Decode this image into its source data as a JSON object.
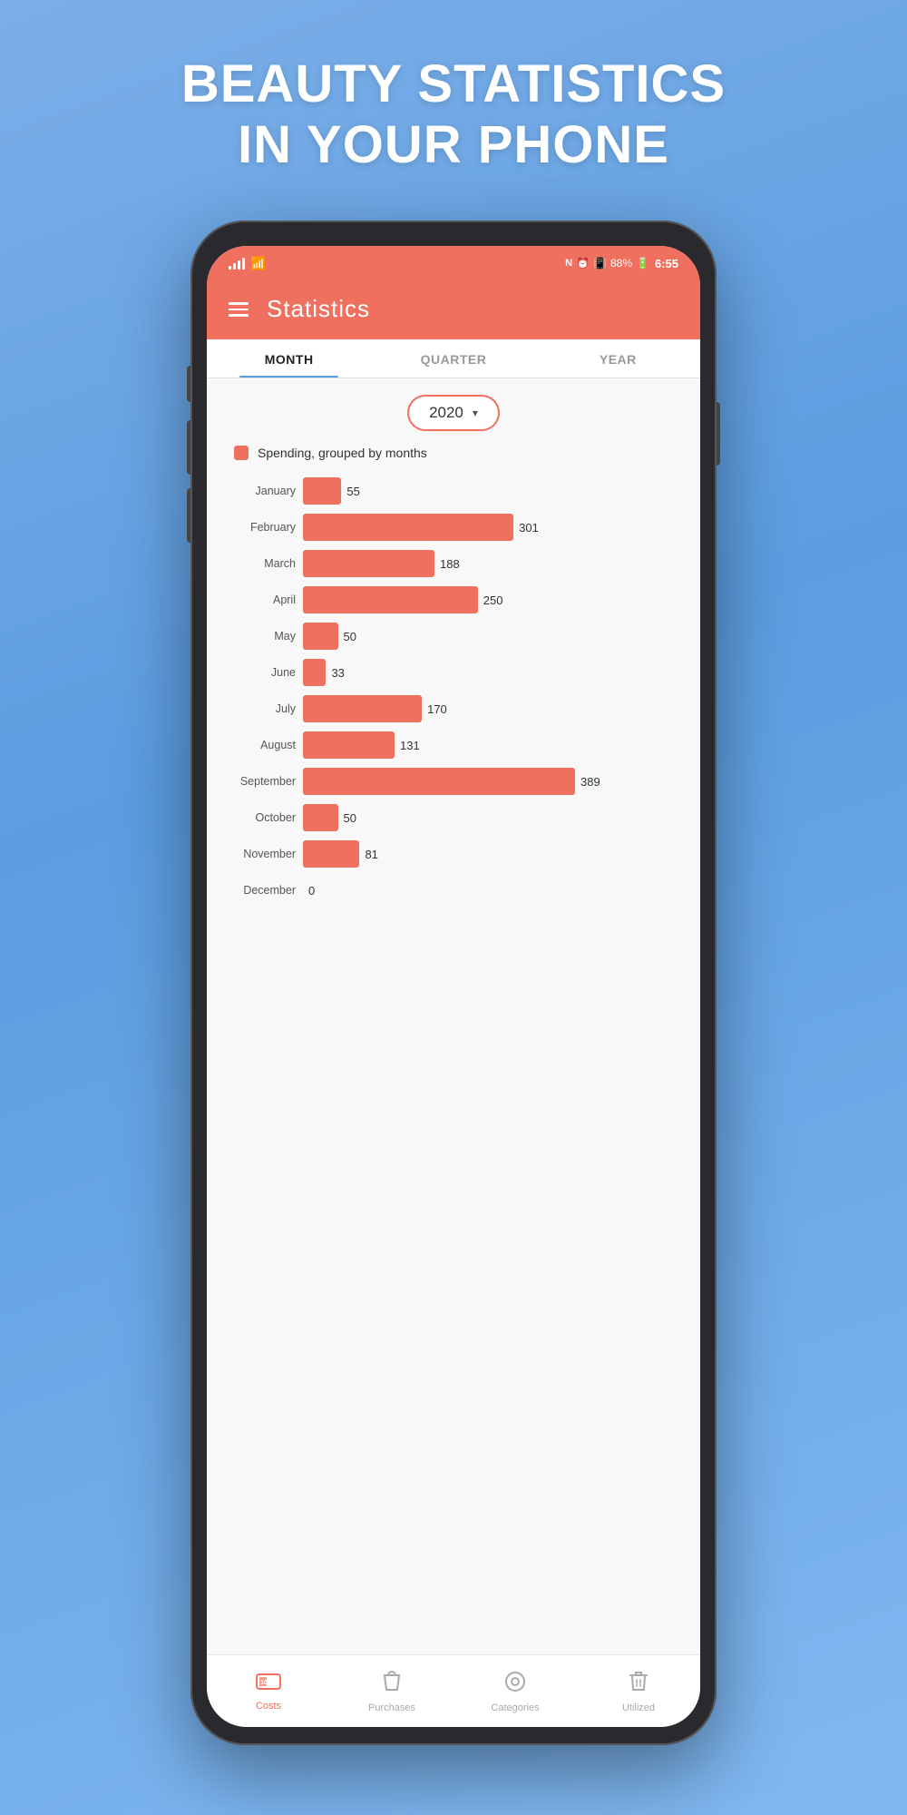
{
  "hero": {
    "line1": "BEAUTY STATISTICS",
    "line2": "IN YOUR PHONE"
  },
  "status_bar": {
    "time": "6:55",
    "battery": "88%",
    "signal": "●●●●",
    "wifi": "wifi"
  },
  "header": {
    "title": "Statistics"
  },
  "tabs": [
    {
      "label": "MONTH",
      "active": true
    },
    {
      "label": "QUARTER",
      "active": false
    },
    {
      "label": "YEAR",
      "active": false
    }
  ],
  "year_selector": {
    "value": "2020"
  },
  "legend": {
    "label": "Spending, grouped by months"
  },
  "chart": {
    "max_value": 389,
    "bar_max_width": 300,
    "bars": [
      {
        "month": "January",
        "value": 55
      },
      {
        "month": "February",
        "value": 301
      },
      {
        "month": "March",
        "value": 188
      },
      {
        "month": "April",
        "value": 250
      },
      {
        "month": "May",
        "value": 50
      },
      {
        "month": "June",
        "value": 33
      },
      {
        "month": "July",
        "value": 170
      },
      {
        "month": "August",
        "value": 131
      },
      {
        "month": "September",
        "value": 389
      },
      {
        "month": "October",
        "value": 50
      },
      {
        "month": "November",
        "value": 81
      },
      {
        "month": "December",
        "value": 0
      }
    ]
  },
  "bottom_nav": [
    {
      "id": "costs",
      "label": "Costs",
      "icon": "💵",
      "active": true
    },
    {
      "id": "purchases",
      "label": "Purchases",
      "icon": "🛍",
      "active": false
    },
    {
      "id": "categories",
      "label": "Categories",
      "icon": "◎",
      "active": false
    },
    {
      "id": "utilized",
      "label": "Utilized",
      "icon": "🗑",
      "active": false
    }
  ]
}
